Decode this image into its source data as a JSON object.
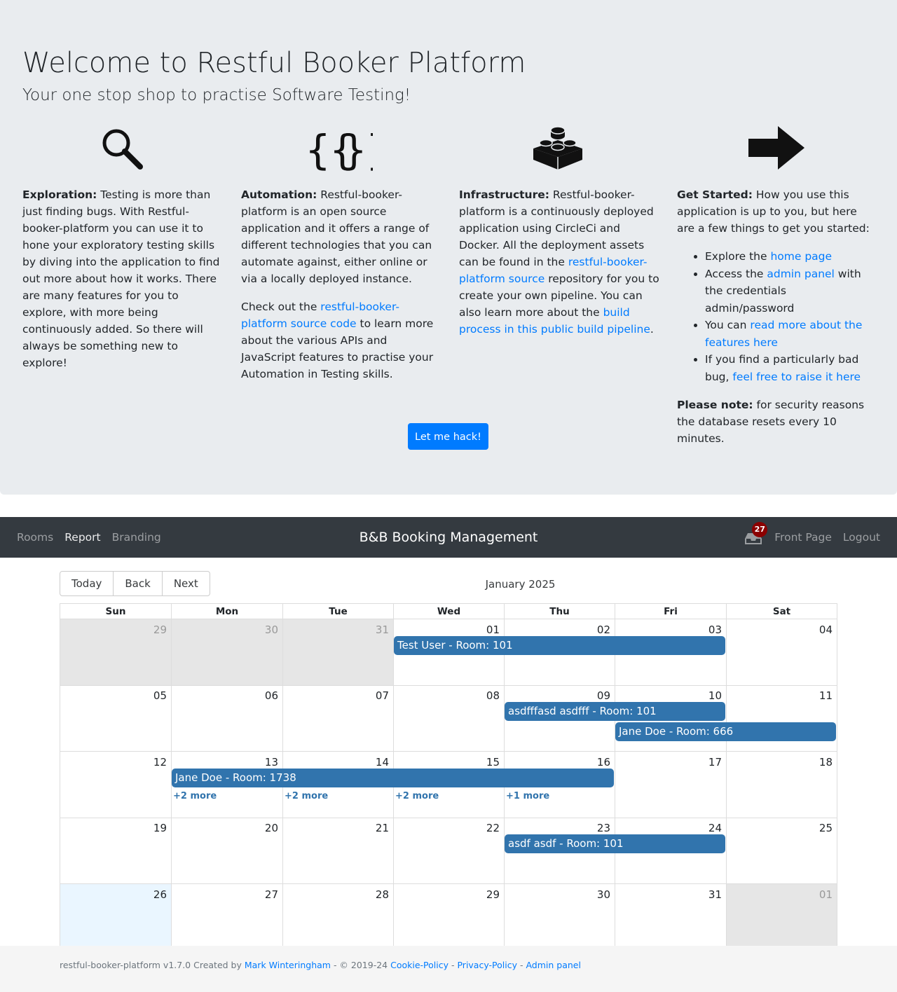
{
  "hero": {
    "title": "Welcome to Restful Booker Platform",
    "subtitle": "Your one stop shop to practise Software Testing!",
    "hack_button": "Let me hack!"
  },
  "features": {
    "exploration": {
      "icon": "magnifier-icon",
      "heading": "Exploration:",
      "text": " Testing is more than just finding bugs. With Restful-booker-platform you can use it to hone your exploratory testing skills by diving into the application to find out more about how it works. There are many features for you to explore, with more being continuously added. So there will always be something new to explore!"
    },
    "automation": {
      "icon": "curly-braces-icon",
      "heading": "Automation:",
      "text": " Restful-booker-platform is an open source application and it offers a range of different technologies that you can automate against, either online or via a locally deployed instance.",
      "p2_prefix": "Check out the ",
      "p2_link": "restful-booker-platform source code",
      "p2_suffix": " to learn more about the various APIs and JavaScript features to practise your Automation in Testing skills."
    },
    "infrastructure": {
      "icon": "lego-brick-icon",
      "heading": "Infrastructure:",
      "text_a": " Restful-booker-platform is a continuously deployed application using CircleCi and Docker. All the deployment assets can be found in the ",
      "link_a": "restful-booker-platform source",
      "text_b": " repository for you to create your own pipeline. You can also learn more about the ",
      "link_b": "build process in this public build pipeline",
      "text_c": "."
    },
    "get_started": {
      "icon": "arrow-right-icon",
      "heading": "Get Started:",
      "text": " How you use this application is up to you, but here are a few things to get you started:",
      "items": [
        {
          "pre": "Explore the ",
          "link": "home page",
          "post": ""
        },
        {
          "pre": "Access the ",
          "link": "admin panel",
          "post": " with the credentials admin/password"
        },
        {
          "pre": "You can ",
          "link": "read more about the features here",
          "post": ""
        },
        {
          "pre": "If you find a particularly bad bug, ",
          "link": "feel free to raise it here",
          "post": ""
        }
      ],
      "note_heading": "Please note:",
      "note_text": " for security reasons the database resets every 10 minutes."
    }
  },
  "navbar": {
    "links": [
      "Rooms",
      "Report",
      "Branding"
    ],
    "active": "Report",
    "brand": "B&B Booking Management",
    "inbox_count": "27",
    "right_links": [
      "Front Page",
      "Logout"
    ]
  },
  "calendar": {
    "toolbar": [
      "Today",
      "Back",
      "Next"
    ],
    "month": "January 2025",
    "weekdays": [
      "Sun",
      "Mon",
      "Tue",
      "Wed",
      "Thu",
      "Fri",
      "Sat"
    ],
    "weeks": [
      [
        "29",
        "30",
        "31",
        "01",
        "02",
        "03",
        "04"
      ],
      [
        "05",
        "06",
        "07",
        "08",
        "09",
        "10",
        "11"
      ],
      [
        "12",
        "13",
        "14",
        "15",
        "16",
        "17",
        "18"
      ],
      [
        "19",
        "20",
        "21",
        "22",
        "23",
        "24",
        "25"
      ],
      [
        "26",
        "27",
        "28",
        "29",
        "30",
        "31",
        "01"
      ]
    ],
    "events": [
      {
        "label": "Test User - Room: 101",
        "week": 0,
        "start": 3,
        "span": 3,
        "lane": 0
      },
      {
        "label": "asdfffasd asdfff - Room: 101",
        "week": 1,
        "start": 4,
        "span": 2,
        "lane": 0
      },
      {
        "label": "Jane Doe - Room: 666",
        "week": 1,
        "start": 5,
        "span": 2,
        "lane": 1
      },
      {
        "label": "Jane Doe - Room: 1738",
        "week": 2,
        "start": 1,
        "span": 4,
        "lane": 0
      },
      {
        "label": "asdf asdf - Room: 101",
        "week": 3,
        "start": 4,
        "span": 2,
        "lane": 0
      }
    ],
    "more": [
      {
        "label": "+2 more",
        "week": 2,
        "day": 1
      },
      {
        "label": "+2 more",
        "week": 2,
        "day": 2
      },
      {
        "label": "+2 more",
        "week": 2,
        "day": 3
      },
      {
        "label": "+1 more",
        "week": 2,
        "day": 4
      }
    ]
  },
  "footer": {
    "prefix": "restful-booker-platform v1.7.0 Created by ",
    "author": "Mark Winteringham",
    "middle": " - © 2019-24 ",
    "links": [
      "Cookie-Policy",
      "Privacy-Policy",
      "Admin panel"
    ],
    "sep": " - "
  },
  "colors": {
    "primary": "#007bff",
    "navbar_bg": "#343a40",
    "event_bg": "#3174ad",
    "badge_bg": "#8b0000",
    "hero_bg": "#e9ecef"
  }
}
